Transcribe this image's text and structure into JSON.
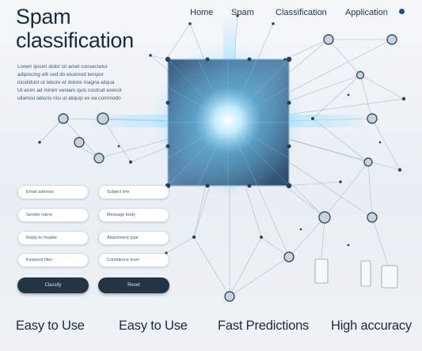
{
  "title": {
    "line1": "Spam",
    "line2": "classification"
  },
  "nav": {
    "home": "Home",
    "spam": "Spam",
    "classification": "Classification",
    "application": "Application"
  },
  "blurb": {
    "lines": [
      "Lorem ipsum dolor sit amet consectetur",
      "adipiscing elit sed do eiusmod tempor",
      "incididunt ut labore et dolore magna aliqua",
      "Ut enim ad minim veniam quis nostrud exercit",
      "ullamco laboris nisi ut aliquip ex ea commodo"
    ]
  },
  "form": {
    "fields": [
      "Email address",
      "Subject line",
      "Sender name",
      "Message body",
      "Reply-to header",
      "Attachment type",
      "Keyword filter",
      "Confidence level"
    ],
    "buttons": [
      "Classify",
      "Reset"
    ]
  },
  "features": [
    "Easy to Use",
    "Easy to Use",
    "Fast Predictions",
    "High accuracy"
  ],
  "colors": {
    "accent": "#1e4f86",
    "button": "#243444",
    "glow": "#7fd4ff",
    "square": "#2f4f6d"
  }
}
